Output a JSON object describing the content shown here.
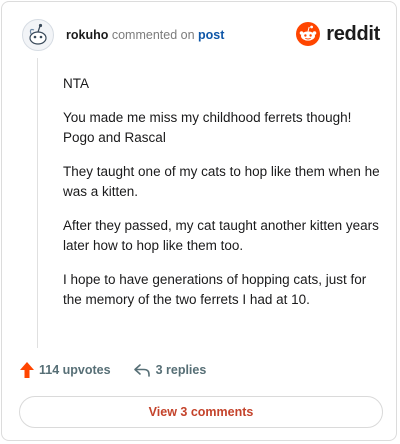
{
  "comment": {
    "author": "rokuho",
    "verb": "commented on",
    "post_link": "post"
  },
  "brand": {
    "name": "reddit",
    "icon": "reddit-snoo-icon",
    "color": "#ff4500"
  },
  "avatar": {
    "icon": "snoo-avatar-icon"
  },
  "body": {
    "paragraphs": [
      "NTA",
      "You made me miss my childhood ferrets though! Pogo and Rascal",
      "They taught one of my cats to hop like them when he was a kitten.",
      "After they passed, my cat taught another kitten years later how to hop like them too.",
      "I hope to have generations of hopping cats, just for the memory of the two ferrets I had at 10."
    ]
  },
  "actions": {
    "upvotes": "114 upvotes",
    "upvote_icon": "upvote-arrow-icon",
    "upvote_color": "#ff4500",
    "replies": "3 replies",
    "reply_icon": "reply-arrow-icon"
  },
  "footer": {
    "view_comments": "View 3 comments",
    "accent": "#c4432b"
  }
}
